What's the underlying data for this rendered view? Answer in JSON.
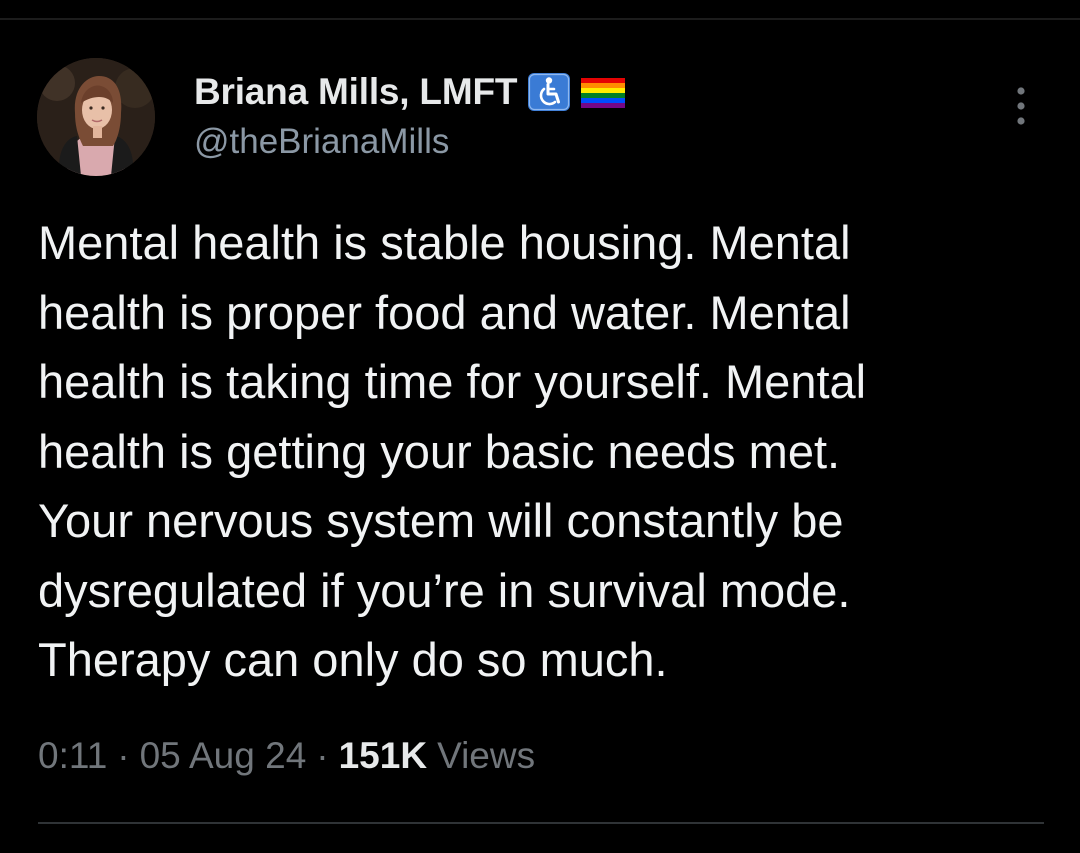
{
  "author": {
    "display_name": "Briana Mills, LMFT",
    "handle": "@theBrianaMills",
    "badges": [
      "wheelchair-symbol-icon",
      "rainbow-flag-icon"
    ]
  },
  "tweet": {
    "text": "Mental health is stable housing. Mental\nhealth is proper food and water. Mental\nhealth is taking time for yourself. Mental\nhealth is getting your basic needs met.\nYour nervous system will constantly be\ndysregulated if you’re in survival mode.\nTherapy can only do so much."
  },
  "meta": {
    "time": "0:11",
    "separator": "·",
    "date": "05 Aug 24",
    "views_count": "151K",
    "views_label": "Views"
  },
  "colors": {
    "background": "#000000",
    "primary_text": "#e7e9ea",
    "secondary_text": "#71767b",
    "divider": "#2f3336"
  }
}
